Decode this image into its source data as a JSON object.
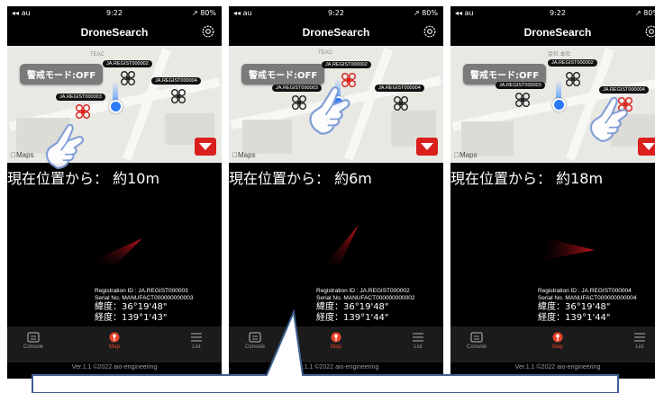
{
  "status": {
    "signal": "◂◂ au",
    "time": "9:22",
    "battery": "↗ 80%"
  },
  "app_title": "DroneSearch",
  "mode_button": "警戒モード:OFF",
  "maps_label": "Maps",
  "tabs": {
    "console": "Console",
    "map": "Map",
    "list": "List"
  },
  "version": "Ver.1.1 ©2022 aio-engineering",
  "map_labels": {
    "teac": "TEAC",
    "place": "会社 本社"
  },
  "phones": [
    {
      "drone_tags": [
        "JA.REGIST000002",
        "JA.REGIST000004",
        "JA.REGIST000003"
      ],
      "distance": "現在位置から： 約10m",
      "info": {
        "reg": "Registration ID : JA.REGIST000003",
        "serial": "Serial No. MANUFACT000000000003",
        "lat": "緯度：36°19'48\"",
        "lon": "経度：139°1'43\""
      }
    },
    {
      "drone_tags": [
        "JA.REGIST000002",
        "JA.REGIST000004",
        "JA.REGIST000003"
      ],
      "distance": "現在位置から： 約6m",
      "info": {
        "reg": "Registration ID : JA.REGIST000002",
        "serial": "Serial No. MANUFACT000000000002",
        "lat": "緯度：36°19'48\"",
        "lon": "経度：139°1'44\""
      }
    },
    {
      "drone_tags": [
        "JA.REGIST000002",
        "JA.REGIST000004",
        "JA.REGIST000003"
      ],
      "distance": "現在位置から： 約18m",
      "info": {
        "reg": "Registration ID : JA.REGIST000004",
        "serial": "Serial No. MANUFACT000000000004",
        "lat": "緯度：36°19'48\"",
        "lon": "経度：139°1'44\""
      }
    }
  ],
  "colors": {
    "accent": "#e8432a",
    "drone_selected": "#d9201c",
    "user": "#2d7cf6"
  },
  "icons": [
    "settings-gear-icon",
    "drone-icon",
    "dropdown-triangle-icon",
    "console-icon",
    "map-pin-icon",
    "list-icon",
    "pointing-hand-icon"
  ]
}
